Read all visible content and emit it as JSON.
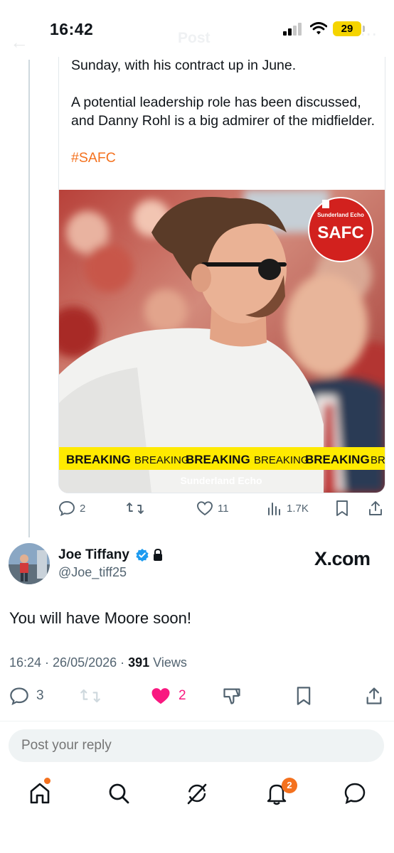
{
  "status_bar": {
    "time": "16:42",
    "battery": "29",
    "header_title": "Post"
  },
  "quoted_post": {
    "paragraph_1": "Sunday, with his contract up in June.",
    "paragraph_2": "A potential leadership role has been discussed, and Danny Rohl is a big admirer of the midfielder.",
    "hashtag": "#SAFC",
    "image": {
      "logo_top": "Sunderland Echo",
      "logo_main": "SAFC",
      "banner_text": [
        "BREAKING",
        "BREAKING",
        "BREAKING",
        "BREAKING",
        "BREAKING",
        "BRE"
      ],
      "watermark": "Sunderland Echo"
    },
    "actions": {
      "replies": "2",
      "likes": "11",
      "views": "1.7K"
    }
  },
  "reply": {
    "author_name": "Joe Tiffany",
    "author_handle": "@Joe_tiff25",
    "source_badge": "X.com",
    "text": "You will have Moore soon!",
    "timestamp": "16:24 · 26/05/2026 · ",
    "views_count": "391",
    "views_label": " Views",
    "actions": {
      "replies": "3",
      "likes": "2"
    },
    "like_color": "#f91880"
  },
  "composer": {
    "placeholder": "Post your reply"
  },
  "tab_bar": {
    "items": [
      "home-icon",
      "search-icon",
      "grok-icon",
      "notifications-icon",
      "messages-icon"
    ],
    "notification_count": "2"
  },
  "colors": {
    "accent": "#f4711e",
    "verified": "#1d9bf0",
    "banner_yellow": "#ffea00"
  }
}
